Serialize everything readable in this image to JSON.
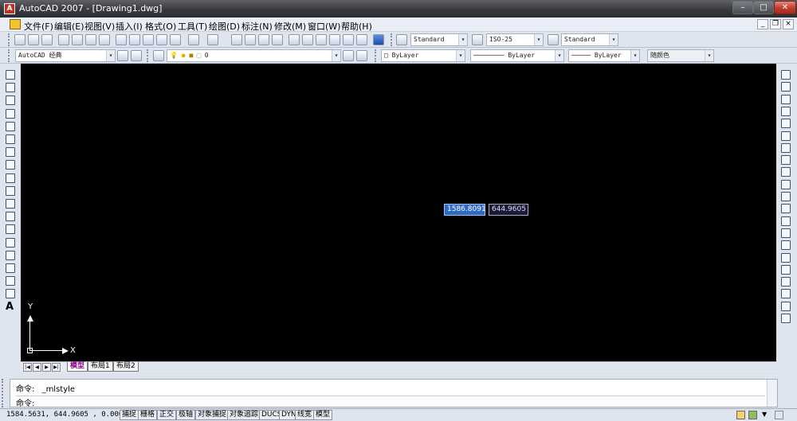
{
  "window": {
    "title": "AutoCAD 2007 - [Drawing1.dwg]",
    "app_icon_glyph": "A",
    "controls": {
      "minimize": "–",
      "maximize": "□",
      "close": "✕"
    }
  },
  "menubar": {
    "items": [
      {
        "label": "文件(F)"
      },
      {
        "label": "编辑(E)"
      },
      {
        "label": "视图(V)"
      },
      {
        "label": "插入(I)"
      },
      {
        "label": "格式(O)"
      },
      {
        "label": "工具(T)"
      },
      {
        "label": "绘图(D)"
      },
      {
        "label": "标注(N)"
      },
      {
        "label": "修改(M)"
      },
      {
        "label": "窗口(W)"
      },
      {
        "label": "帮助(H)"
      }
    ],
    "doc_controls": {
      "minimize": "_",
      "restore": "❐",
      "close": "×"
    }
  },
  "toolbar1": {
    "text_style": "Standard",
    "dim_style": "ISO-25",
    "table_style": "Standard"
  },
  "toolbar2": {
    "workspace": "AutoCAD 经典",
    "layer": "0",
    "color": "ByLayer",
    "linetype": "ByLayer",
    "lineweight": "ByLayer",
    "plot_style": "随颜色"
  },
  "canvas": {
    "background": "#000000",
    "dynamic_input": {
      "x": "1586.8091",
      "y": "644.9605"
    },
    "ucs": {
      "x_label": "X",
      "y_label": "Y"
    }
  },
  "left_toolbar": {
    "tools": [
      "line-icon",
      "construction-line-icon",
      "polyline-icon",
      "polygon-icon",
      "rectangle-icon",
      "arc-icon",
      "circle-icon",
      "revision-cloud-icon",
      "spline-icon",
      "ellipse-icon",
      "ellipse-arc-icon",
      "insert-block-icon",
      "make-block-icon",
      "point-icon",
      "hatch-icon",
      "gradient-icon",
      "region-icon",
      "table-icon",
      "multiline-text-icon"
    ],
    "text_tool_glyph": "A"
  },
  "right_toolbar": {
    "tools": [
      "erase-icon",
      "copy-icon",
      "mirror-icon",
      "offset-icon",
      "array-icon",
      "move-icon",
      "rotate-icon",
      "scale-icon",
      "stretch-icon",
      "trim-icon",
      "extend-icon",
      "break-at-point-icon",
      "break-icon",
      "join-icon",
      "chamfer-icon",
      "fillet-icon",
      "explode-icon",
      "bring-front-icon",
      "send-back-icon",
      "bring-above-icon",
      "send-under-icon"
    ]
  },
  "layout_tabs": {
    "nav": [
      "|◀",
      "◀",
      "▶",
      "▶|"
    ],
    "tabs": [
      {
        "label": "模型"
      },
      {
        "label": "布局1"
      },
      {
        "label": "布局2"
      }
    ]
  },
  "command": {
    "lines": [
      {
        "prompt": "命令:",
        "text": "_mlstyle"
      },
      {
        "prompt": "命令:",
        "text": ""
      }
    ]
  },
  "statusbar": {
    "coordinates": "1584.5631, 644.9605 , 0.0000",
    "buttons": [
      {
        "label": "捕捉"
      },
      {
        "label": "栅格"
      },
      {
        "label": "正交"
      },
      {
        "label": "极轴"
      },
      {
        "label": "对象捕捉"
      },
      {
        "label": "对象追踪"
      },
      {
        "label": "DUCS"
      },
      {
        "label": "DYN"
      },
      {
        "label": "线宽"
      },
      {
        "label": "模型"
      }
    ]
  },
  "colors": {
    "title_bar": "#3a3b40",
    "menu_bar": "#e9edf5",
    "toolbar": "#dfe5ef",
    "model_tab_text": "#8b008b",
    "dyn_input_active": "#2d6bc7",
    "close_button": "#c13b2a"
  }
}
